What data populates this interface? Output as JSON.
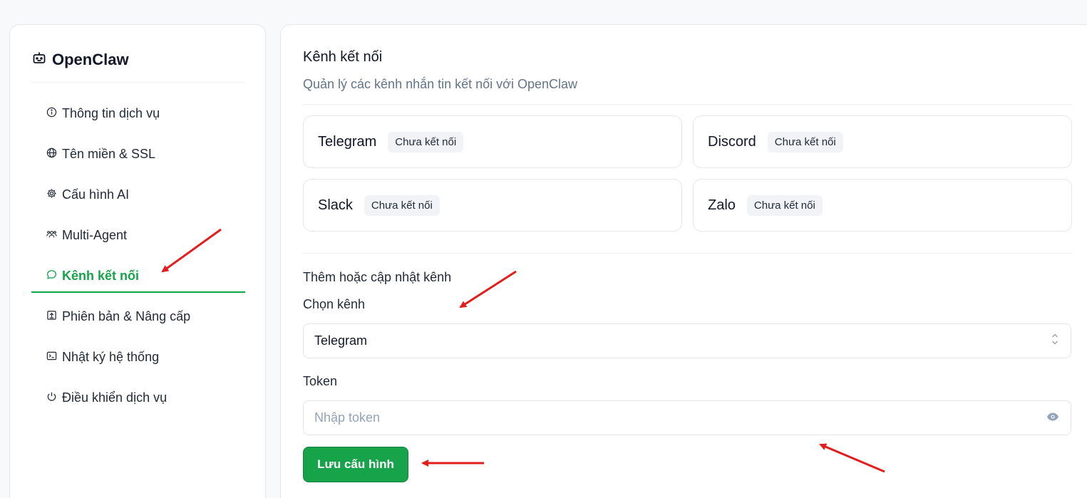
{
  "sidebar": {
    "brand": "OpenClaw",
    "items": [
      {
        "label": "Thông tin dịch vụ",
        "icon": "info-icon",
        "active": false
      },
      {
        "label": "Tên miền & SSL",
        "icon": "globe-icon",
        "active": false
      },
      {
        "label": "Cấu hình AI",
        "icon": "gear-icon",
        "active": false
      },
      {
        "label": "Multi-Agent",
        "icon": "users-icon",
        "active": false
      },
      {
        "label": "Kênh kết nối",
        "icon": "message-icon",
        "active": true
      },
      {
        "label": "Phiên bản & Nâng cấp",
        "icon": "upgrade-icon",
        "active": false
      },
      {
        "label": "Nhật ký hệ thống",
        "icon": "terminal-icon",
        "active": false
      },
      {
        "label": "Điều khiển dịch vụ",
        "icon": "power-icon",
        "active": false
      }
    ]
  },
  "main": {
    "title": "Kênh kết nối",
    "subtitle": "Quản lý các kênh nhắn tin kết nối với OpenClaw",
    "channels": [
      {
        "name": "Telegram",
        "status": "Chưa kết nối"
      },
      {
        "name": "Discord",
        "status": "Chưa kết nối"
      },
      {
        "name": "Slack",
        "status": "Chưa kết nối"
      },
      {
        "name": "Zalo",
        "status": "Chưa kết nối"
      }
    ],
    "form": {
      "heading": "Thêm hoặc cập nhật kênh",
      "channel_label": "Chọn kênh",
      "channel_value": "Telegram",
      "token_label": "Token",
      "token_placeholder": "Nhập token",
      "save_label": "Lưu cấu hình"
    }
  },
  "colors": {
    "accent": "#16a34a",
    "annotation_arrow": "#e11d1d"
  }
}
